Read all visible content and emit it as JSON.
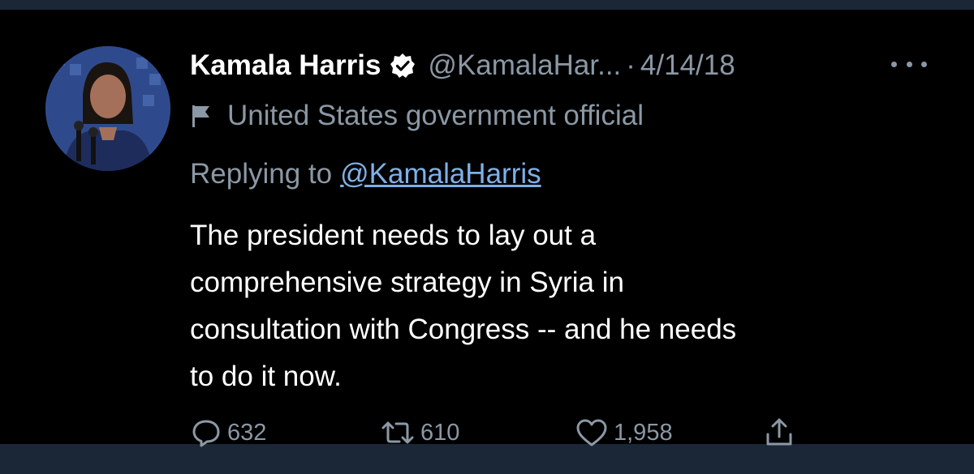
{
  "tweet": {
    "author_name": "Kamala Harris",
    "handle": "@KamalaHar...",
    "separator": "·",
    "date": "4/14/18",
    "account_label": "United States government official",
    "replying_prefix": "Replying to",
    "replying_to": "@KamalaHarris",
    "text_lines": [
      "The president needs to lay out a",
      "comprehensive strategy in Syria in",
      "consultation with Congress -- and he needs",
      "to do it now."
    ],
    "replies": "632",
    "retweets": "610",
    "likes": "1,958"
  },
  "icons": {
    "verified": "verified-badge-icon",
    "label": "flag-icon",
    "more": "more-icon",
    "reply": "reply-icon",
    "retweet": "retweet-icon",
    "like": "heart-icon",
    "share": "share-icon"
  },
  "colors": {
    "background": "#000000",
    "frame": "#1b2636",
    "primary_text": "#ffffff",
    "secondary_text": "#8b98a5",
    "link": "#7fb0e8"
  }
}
